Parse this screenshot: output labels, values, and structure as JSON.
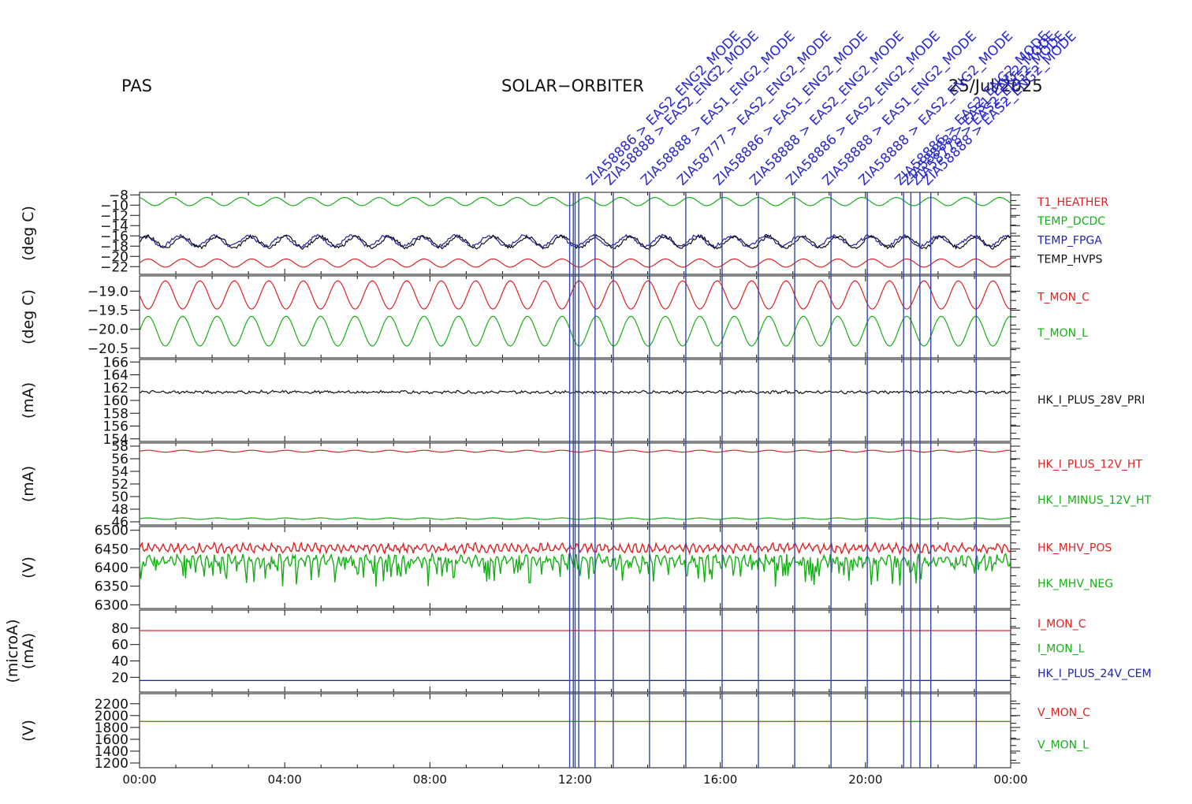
{
  "header": {
    "instrument": "PAS",
    "mission": "SOLAR−ORBITER",
    "date": "25/Jul/2025"
  },
  "colors": {
    "red": "#dd2222",
    "green": "#16b016",
    "blue": "#2222aa",
    "black": "#111111",
    "marker_line": "#3344aa",
    "marker_text": "#2a2acc"
  },
  "chart_data": {
    "type": "line",
    "time_axis": {
      "range_hours": [
        0,
        24
      ],
      "ticks": [
        "00:00",
        "04:00",
        "08:00",
        "12:00",
        "16:00",
        "20:00",
        "00:00"
      ]
    },
    "event_markers": {
      "times_hours": [
        11.85,
        11.95,
        12.0,
        12.1,
        12.55,
        13.05,
        14.05,
        15.05,
        16.05,
        17.05,
        18.05,
        19.05,
        20.05,
        21.05,
        21.25,
        21.5,
        21.8,
        23.05
      ],
      "labels": [
        "ZIA58886 > EAS2_ENG2_MODE",
        "ZIA58888 > EAS2_ENG2_MODE",
        "ZIA58888 > EAS1_ENG2_MODE",
        "ZIA58777 > EAS2_ENG2_MODE",
        "ZIA58886 > EAS1_ENG2_MODE",
        "ZIA58888 > EAS2_ENG2_MODE",
        "ZIA58886 > EAS2_ENG2_MODE",
        "ZIA58888 > EAS1_ENG2_MODE",
        "ZIA58888 > EAS2_ENG2_MODE",
        "ZIA58886 > EAS2_ENG2_MODE",
        "ZIA58888 > EAS1_ENG2_MODE",
        "ZIA58778 > EAS2_ENG2_MODE",
        "ZIA58888 > EAS2_ENG2_MODE"
      ]
    },
    "panels": [
      {
        "ylabel": "(deg C)",
        "yrange": [
          -23.5,
          -7.5
        ],
        "yticks": [
          -8,
          -10,
          -12,
          -14,
          -16,
          -18,
          -20,
          -22
        ],
        "ytick_labels": [
          "−8",
          "−10",
          "−12",
          "−14",
          "−16",
          "−18",
          "−20",
          "−22"
        ],
        "series": [
          {
            "name": "T1_HEATHER",
            "color": "red",
            "base": -21.3,
            "amp": 0.8,
            "period_h": 0.95
          },
          {
            "name": "TEMP_DCDC",
            "color": "green",
            "base": -9.3,
            "amp": 0.8,
            "period_h": 0.95,
            "phase": 0.3
          },
          {
            "name": "TEMP_FPGA",
            "color": "blue",
            "base": -17.0,
            "amp": 1.0,
            "period_h": 0.95,
            "phase": 0.1
          },
          {
            "name": "TEMP_HVPS",
            "color": "black",
            "base": -17.2,
            "amp": 1.1,
            "period_h": 0.95,
            "phase": 0.0
          }
        ]
      },
      {
        "ylabel": "(deg C)",
        "yrange": [
          -20.75,
          -18.6
        ],
        "yticks": [
          -19.0,
          -19.5,
          -20.0,
          -20.5
        ],
        "ytick_labels": [
          "−19.0",
          "−19.5",
          "−20.0",
          "−20.5"
        ],
        "series": [
          {
            "name": "T_MON_C",
            "color": "red",
            "base": -19.1,
            "amp": 0.37,
            "period_h": 0.95,
            "phase": 0.5
          },
          {
            "name": "T_MON_L",
            "color": "green",
            "base": -20.05,
            "amp": 0.39,
            "period_h": 0.95,
            "phase": 0.0
          }
        ]
      },
      {
        "ylabel": "(mA)",
        "yrange": [
          153.6,
          166.4
        ],
        "yticks": [
          154,
          156,
          158,
          160,
          162,
          164,
          166
        ],
        "ytick_labels": [
          "154",
          "156",
          "158",
          "160",
          "162",
          "164",
          "166"
        ],
        "series": [
          {
            "name": "HK_I_PLUS_28V_PRI",
            "color": "black",
            "base": 161.3,
            "amp": 0.1,
            "period_h": 0.3
          }
        ]
      },
      {
        "ylabel": "(mA)",
        "yrange": [
          45.5,
          58.5
        ],
        "yticks": [
          46,
          48,
          50,
          52,
          54,
          56,
          58
        ],
        "ytick_labels": [
          "46",
          "48",
          "50",
          "52",
          "54",
          "56",
          "58"
        ],
        "series": [
          {
            "name": "HK_I_PLUS_12V_HT",
            "color": "red",
            "base": 57.2,
            "amp": 0.15,
            "period_h": 0.95
          },
          {
            "name": "HK_I_MINUS_12V_HT",
            "color": "green",
            "base": 46.5,
            "amp": 0.12,
            "period_h": 0.95
          }
        ]
      },
      {
        "ylabel": "(V)",
        "yrange": [
          6290,
          6510
        ],
        "yticks": [
          6300,
          6350,
          6400,
          6450,
          6500
        ],
        "ytick_labels": [
          "6300",
          "6350",
          "6400",
          "6450",
          "6500"
        ],
        "series": [
          {
            "name": "HK_MHV_POS",
            "color": "red",
            "base": 6452,
            "amp": 8,
            "period_h": 0.2
          },
          {
            "name": "HK_MHV_NEG",
            "color": "green",
            "base": 6420,
            "amp": 12,
            "period_h": 0.2
          }
        ]
      },
      {
        "ylabel": "(mA)",
        "ylabel2": "(microA)",
        "yrange": [
          2,
          102
        ],
        "yticks": [
          20,
          40,
          60,
          80
        ],
        "ytick_labels": [
          "20",
          "40",
          "60",
          "80"
        ],
        "series": [
          {
            "name": "I_MON_C",
            "color": "red",
            "base": 77,
            "amp": 0,
            "period_h": 1
          },
          {
            "name": "I_MON_L",
            "color": "green",
            "base": 16,
            "amp": 0,
            "period_h": 1
          },
          {
            "name": "HK_I_PLUS_24V_CEM",
            "color": "blue",
            "base": 16,
            "amp": 0,
            "period_h": 1
          }
        ]
      },
      {
        "ylabel": "(V)",
        "yrange": [
          1120,
          2370
        ],
        "yticks": [
          1200,
          1400,
          1600,
          1800,
          2000,
          2200
        ],
        "ytick_labels": [
          "1200",
          "1400",
          "1600",
          "1800",
          "2000",
          "2200"
        ],
        "series": [
          {
            "name": "V_MON_C",
            "color": "red",
            "base": 1900,
            "amp": 0,
            "period_h": 1
          },
          {
            "name": "V_MON_L",
            "color": "green",
            "base": 1900,
            "amp": 0,
            "period_h": 1
          }
        ]
      }
    ]
  }
}
